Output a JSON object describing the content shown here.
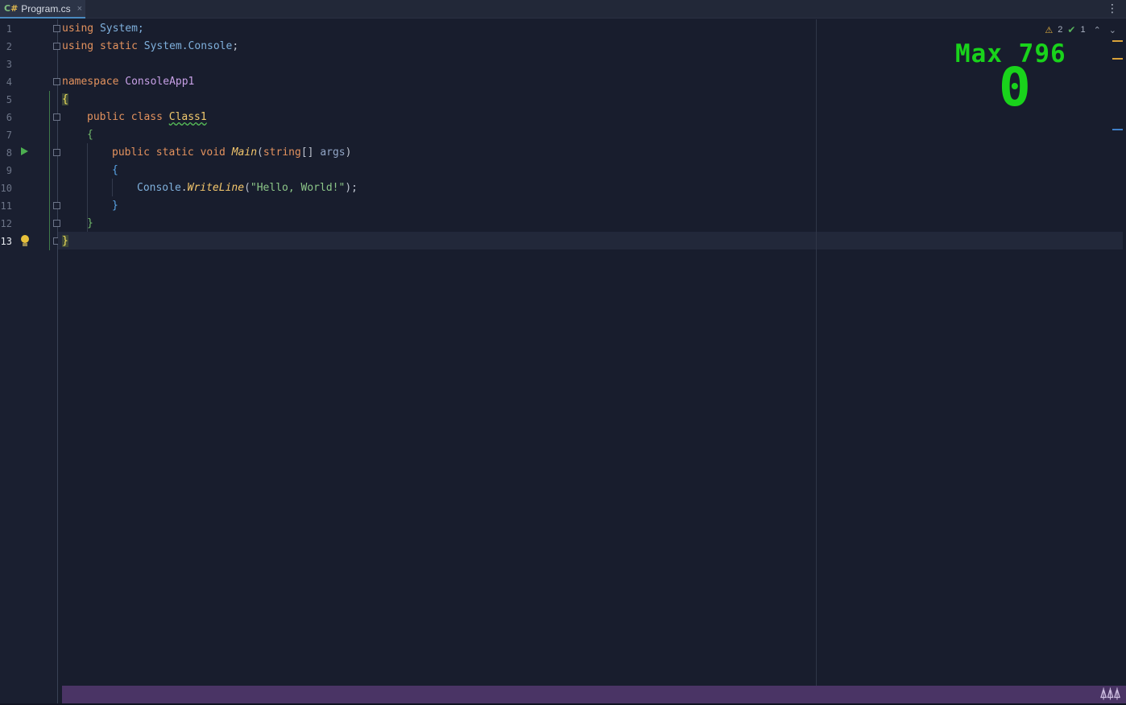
{
  "tab": {
    "lang_icon_c": "C",
    "lang_icon_hash": "#",
    "file": "Program.cs",
    "close": "×"
  },
  "menu": {
    "kebab": "⋮"
  },
  "line_numbers": [
    "1",
    "2",
    "3",
    "4",
    "5",
    "6",
    "7",
    "8",
    "9",
    "10",
    "11",
    "12",
    "13"
  ],
  "code": {
    "l1": {
      "kw": "using",
      "rest": " System;"
    },
    "l2": {
      "kw": "using static",
      "a": " System.",
      "b": "Console",
      "c": ";"
    },
    "l4": {
      "kw": "namespace",
      "ns": " ConsoleApp1"
    },
    "l5": {
      "brace": "{"
    },
    "l6": {
      "kw": "public class ",
      "cls": "Class1"
    },
    "l7": {
      "brace": "{"
    },
    "l8": {
      "kw": "public static void ",
      "meth": "Main",
      "p1": "(",
      "kw2": "string",
      "p2": "[] ",
      "prm": "args",
      "p3": ")"
    },
    "l9": {
      "brace": "{"
    },
    "l10": {
      "tp": "Console",
      "dot": ".",
      "meth": "WriteLine",
      "p1": "(",
      "str": "\"Hello, World!\"",
      "p2": ");"
    },
    "l11": {
      "brace": "}"
    },
    "l12": {
      "brace": "}"
    },
    "l13": {
      "brace": "}"
    }
  },
  "inspections": {
    "warn_icon": "⚠",
    "warn_count": "2",
    "ok_icon": "✔",
    "ok_count": "1",
    "up": "⌃",
    "down": "⌄"
  },
  "game": {
    "max_label": "Max 796",
    "score": "0"
  },
  "bottom": {
    "pixel_icon": "⍋⍋⍋"
  },
  "colors": {
    "accent": "#4a8ac0",
    "game_green": "#19d31b",
    "bottom_bar": "#4a3465"
  }
}
